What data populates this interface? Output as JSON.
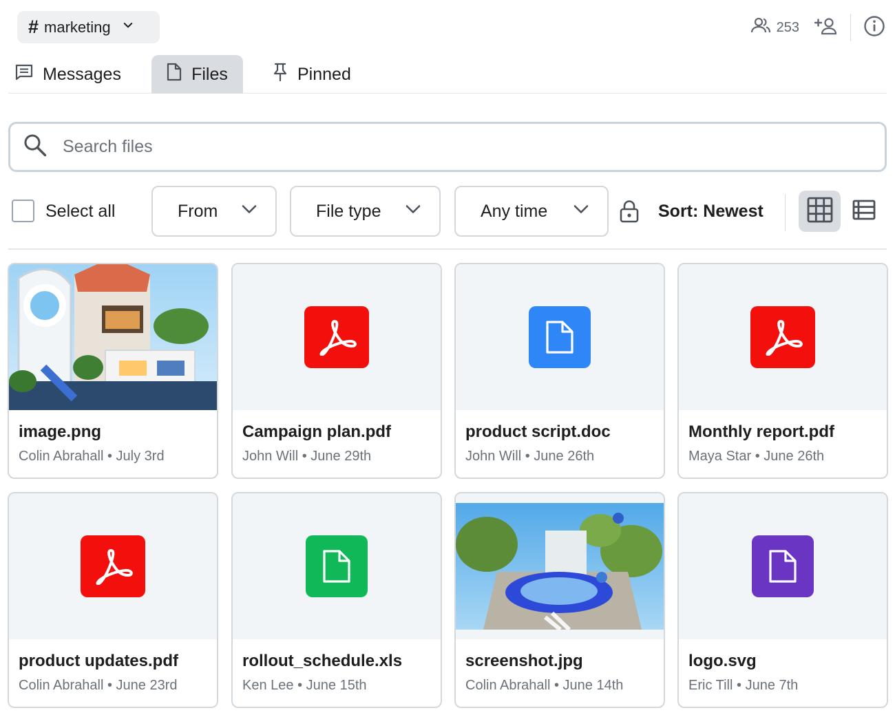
{
  "header": {
    "channel_hash": "#",
    "channel_name": "marketing",
    "member_count": "253"
  },
  "tabs": [
    {
      "label": "Messages",
      "icon": "message-icon"
    },
    {
      "label": "Files",
      "icon": "file-icon",
      "active": true
    },
    {
      "label": "Pinned",
      "icon": "pin-icon"
    }
  ],
  "search": {
    "placeholder": "Search files",
    "value": ""
  },
  "filters": {
    "select_all_label": "Select all",
    "from_label": "From",
    "file_type_label": "File type",
    "time_label": "Any time",
    "sort_label": "Sort: Newest",
    "view_mode": "grid"
  },
  "files": [
    {
      "name": "image.png",
      "author": "Colin Abrahall",
      "date": "July 3rd",
      "kind": "image"
    },
    {
      "name": "Campaign plan.pdf",
      "author": "John Will",
      "date": "June 29th",
      "kind": "pdf"
    },
    {
      "name": "product script.doc",
      "author": "John Will",
      "date": "June 26th",
      "kind": "doc"
    },
    {
      "name": "Monthly report.pdf",
      "author": "Maya Star",
      "date": "June 26th",
      "kind": "pdf"
    },
    {
      "name": "product updates.pdf",
      "author": "Colin Abrahall",
      "date": "June 23rd",
      "kind": "pdf"
    },
    {
      "name": "rollout_schedule.xls",
      "author": "Ken Lee",
      "date": "June 15th",
      "kind": "xls"
    },
    {
      "name": "screenshot.jpg",
      "author": "Colin Abrahall",
      "date": "June 14th",
      "kind": "image"
    },
    {
      "name": "logo.svg",
      "author": "Eric Till",
      "date": "June 7th",
      "kind": "svg"
    }
  ],
  "colors": {
    "pdf": "#f20f0c",
    "doc": "#2f86f6",
    "xls": "#10b858",
    "svg": "#6a35c2",
    "active_tab": "#d9dde2"
  }
}
